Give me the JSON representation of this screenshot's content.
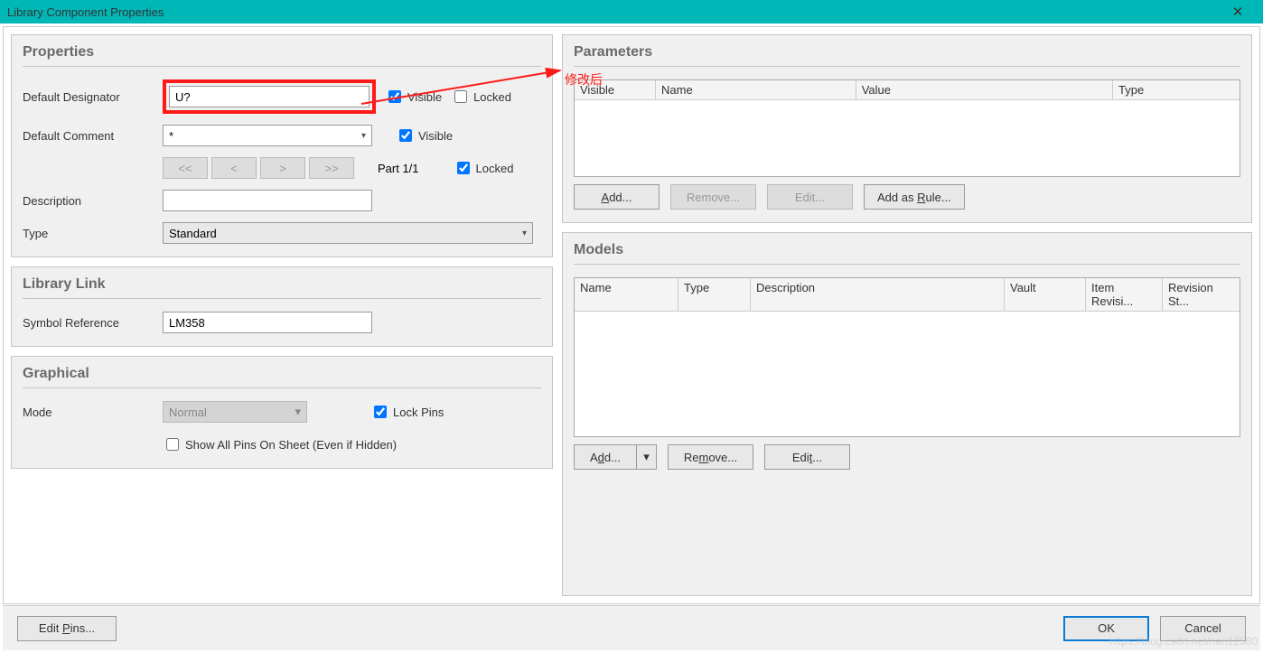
{
  "window": {
    "title": "Library Component Properties",
    "close": "✕"
  },
  "annotation": {
    "text": "修改后"
  },
  "properties": {
    "title": "Properties",
    "designator_label": "Default Designator",
    "designator_value": "U?",
    "visible_label": "Visible",
    "locked_label": "Locked",
    "comment_label": "Default Comment",
    "comment_value": "*",
    "part_prev2": "<<",
    "part_prev": "<",
    "part_next": ">",
    "part_next2": ">>",
    "part_text": "Part 1/1",
    "description_label": "Description",
    "description_value": "",
    "type_label": "Type",
    "type_value": "Standard"
  },
  "library_link": {
    "title": "Library Link",
    "symref_label": "Symbol Reference",
    "symref_value": "LM358"
  },
  "graphical": {
    "title": "Graphical",
    "mode_label": "Mode",
    "mode_value": "Normal",
    "lockpins_label": "Lock Pins",
    "showall_label": "Show All Pins On Sheet (Even if Hidden)"
  },
  "parameters": {
    "title": "Parameters",
    "cols": {
      "visible": "Visible",
      "name": "Name",
      "value": "Value",
      "type": "Type"
    },
    "buttons": {
      "add": "Add...",
      "remove": "Remove...",
      "edit": "Edit...",
      "addrule": "Add as Rule..."
    }
  },
  "models": {
    "title": "Models",
    "cols": {
      "name": "Name",
      "type": "Type",
      "description": "Description",
      "vault": "Vault",
      "itemrev": "Item Revisi...",
      "revst": "Revision St..."
    },
    "buttons": {
      "add": "Add...",
      "remove": "Remove...",
      "edit": "Edit..."
    }
  },
  "footer": {
    "editpins": "Edit Pins...",
    "ok": "OK",
    "cancel": "Cancel"
  },
  "watermark": "https://blog.csdn.net/nan12580"
}
